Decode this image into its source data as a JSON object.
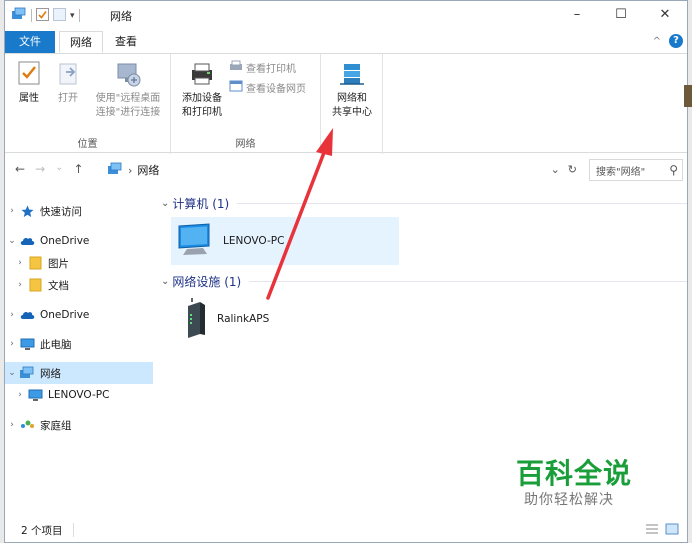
{
  "window": {
    "title": "网络",
    "minimize": "–",
    "maximize": "☐",
    "close": "✕"
  },
  "ribbon": {
    "tabs": [
      {
        "label": "文件"
      },
      {
        "label": "网络"
      },
      {
        "label": "查看"
      }
    ],
    "collapse": "^",
    "help": "?",
    "groups": {
      "location": {
        "label": "位置",
        "properties": "属性",
        "open": "打开",
        "remote_desktop_1": "使用\"远程桌面",
        "remote_desktop_2": "连接\"进行连接"
      },
      "network": {
        "label": "网络",
        "add_device_1": "添加设备",
        "add_device_2": "和打印机",
        "view_printers": "查看打印机",
        "view_device_page": "查看设备网页"
      },
      "sharing": {
        "center_1": "网络和",
        "center_2": "共享中心"
      }
    }
  },
  "address": {
    "back": "←",
    "forward": "→",
    "recent": "⌄",
    "up": "↑",
    "separator": "›",
    "path": "网络",
    "dropdown": "⌄",
    "refresh": "↻",
    "search_placeholder": "搜索\"网络\"",
    "search_icon": "⚲"
  },
  "nav": {
    "expanded": "⌄",
    "collapsed": "›",
    "items": [
      {
        "label": "快速访问"
      },
      {
        "label": "OneDrive"
      },
      {
        "label": "图片"
      },
      {
        "label": "文档"
      },
      {
        "label": "OneDrive"
      },
      {
        "label": "此电脑"
      },
      {
        "label": "网络"
      },
      {
        "label": "LENOVO-PC"
      },
      {
        "label": "家庭组"
      }
    ]
  },
  "content": {
    "groups": [
      {
        "header": "计算机 (1)",
        "items": [
          {
            "name": "LENOVO-PC"
          }
        ]
      },
      {
        "header": "网络设施 (1)",
        "items": [
          {
            "name": "RalinkAPS"
          }
        ]
      }
    ]
  },
  "status": {
    "count": "2 个项目"
  },
  "watermark": {
    "title": "百科全说",
    "subtitle": "助你轻松解决"
  },
  "colors": {
    "accent": "#1979ca",
    "selection": "#cce8ff",
    "arrow": "#e8333a",
    "watermark": "#1a9e3a"
  }
}
